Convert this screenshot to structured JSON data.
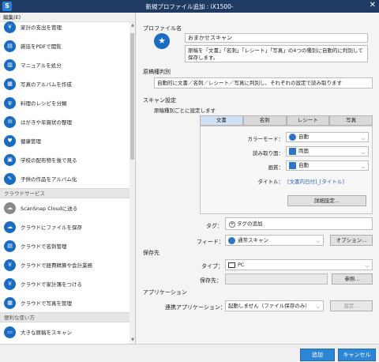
{
  "window": {
    "title": "新規プロファイル追加 : iX1500-",
    "close": "✕"
  },
  "sidebar": {
    "edit_menu": "編集(E)",
    "items": [
      {
        "label": "家計の支出を管理",
        "icon": "￥"
      },
      {
        "label": "雑誌をPDFで閲覧",
        "icon": "▤"
      },
      {
        "label": "マニュアルを処分",
        "icon": "▥"
      },
      {
        "label": "写真のアルバムを作成",
        "icon": "▦"
      },
      {
        "label": "料理のレシピを分類",
        "icon": "ψ"
      },
      {
        "label": "はがきや年賀状の整理",
        "icon": "✉"
      },
      {
        "label": "健康管理",
        "icon": "♥"
      },
      {
        "label": "学校の配布物を後で見る",
        "icon": "▣"
      },
      {
        "label": "子供の作品をアルバム化",
        "icon": "✎"
      }
    ],
    "section_cloud": "クラウドサービス",
    "cloud_items": [
      {
        "label": "ScanSnap Cloudに送る",
        "icon": "☁"
      },
      {
        "label": "クラウドにファイルを保存",
        "icon": "☁"
      },
      {
        "label": "クラウドで名刺管理",
        "icon": "▤"
      },
      {
        "label": "クラウドで経費精算や会計業務",
        "icon": "￥"
      },
      {
        "label": "クラウドで家計簿をつける",
        "icon": "￥"
      },
      {
        "label": "クラウドで写真を管理",
        "icon": "▦"
      }
    ],
    "section_useful": "便利な使い方",
    "useful_items": [
      {
        "label": "大きな原稿をスキャン",
        "icon": "▭"
      },
      {
        "label": "封筒や伝票をスキャン",
        "icon": "✉"
      }
    ]
  },
  "profile": {
    "section_label": "プロファイル名",
    "name": "おまかせスキャン",
    "description": "原稿を「文書」「名刺」「レシート」「写真」の4つの種別に自動的に判別して保存します。"
  },
  "doc_type": {
    "label": "原稿種判別",
    "value": "自動的に文書／名刺／レシート／写真に判別し、それぞれの設定で読み取ります"
  },
  "scan_settings": {
    "label": "スキャン設定",
    "per_type_label": "原稿種別ごとに設定します",
    "tabs": [
      "文書",
      "名刺",
      "レシート",
      "写真"
    ],
    "color_mode_label": "カラーモード：",
    "color_mode_value": "自動",
    "sides_label": "読み取り面：",
    "sides_value": "両面",
    "quality_label": "画質：",
    "quality_value": "自動",
    "title_label": "タイトル：",
    "title_value": "[文書内日付]_[タイトル]",
    "detail_button": "詳細設定..."
  },
  "tag": {
    "label": "タグ：",
    "add_label": "タグの追加"
  },
  "feed": {
    "label": "フィード：",
    "value": "通常スキャン",
    "option_button": "オプション..."
  },
  "destination": {
    "label": "保存先",
    "type_label": "タイプ：",
    "type_value": "PC",
    "folder_label": "保存先：",
    "browse_button": "参照..."
  },
  "application": {
    "label": "アプリケーション",
    "link_label": "連携アプリケーション：",
    "link_value": "起動しません（ファイル保存のみ）",
    "settings_button": "設定..."
  },
  "footer": {
    "add_button": "追加",
    "cancel_button": "キャンセル"
  },
  "colors": {
    "titlebar": "#1f3b64",
    "accent": "#2e87d6",
    "icon": "#1a6bc4"
  }
}
